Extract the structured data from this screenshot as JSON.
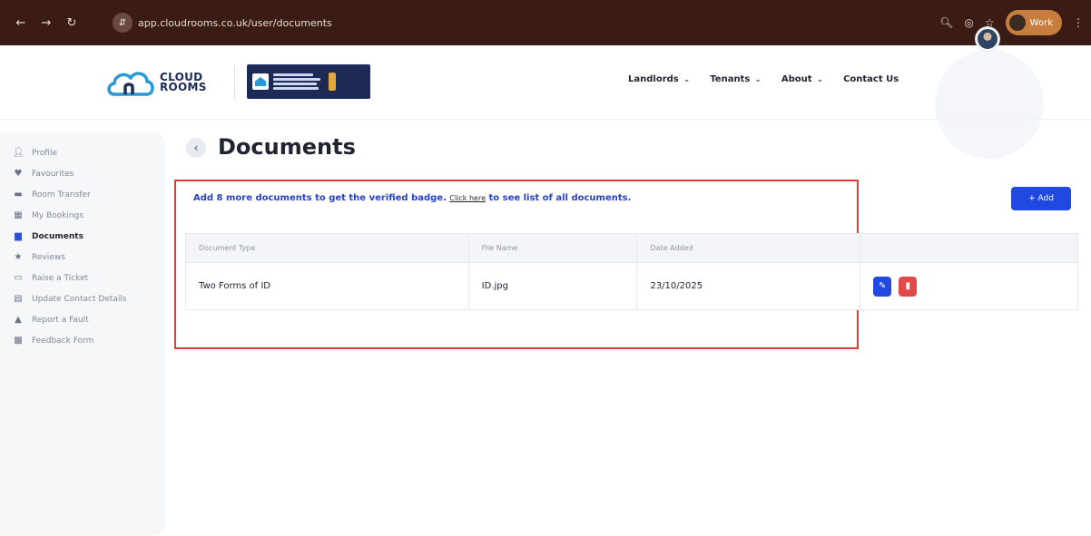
{
  "browser": {
    "url": "app.cloudrooms.co.uk/user/documents",
    "profile_label": "Work"
  },
  "header": {
    "logo_line1": "CLOUD",
    "logo_line2": "ROOMS",
    "nav": [
      {
        "label": "Landlords"
      },
      {
        "label": "Tenants"
      },
      {
        "label": "About"
      },
      {
        "label": "Contact Us"
      }
    ]
  },
  "sidebar": {
    "items": [
      {
        "label": "Profile",
        "icon": "person-icon"
      },
      {
        "label": "Favourites",
        "icon": "heart-icon"
      },
      {
        "label": "Room Transfer",
        "icon": "bed-icon"
      },
      {
        "label": "My Bookings",
        "icon": "building-icon"
      },
      {
        "label": "Documents",
        "icon": "document-icon",
        "active": true
      },
      {
        "label": "Reviews",
        "icon": "star-icon"
      },
      {
        "label": "Raise a Ticket",
        "icon": "ticket-icon"
      },
      {
        "label": "Update Contact Details",
        "icon": "contact-card-icon"
      },
      {
        "label": "Report a Fault",
        "icon": "warning-icon"
      },
      {
        "label": "Feedback Form",
        "icon": "form-icon"
      }
    ]
  },
  "main": {
    "title": "Documents",
    "verify_prefix": "Add 8 more documents to get the verified badge.",
    "click_here": "Click here",
    "verify_suffix": "to see list of all documents.",
    "add_button": "+ Add",
    "table": {
      "headers": [
        "Document Type",
        "File Name",
        "Date Added",
        ""
      ],
      "rows": [
        {
          "type": "Two Forms of ID",
          "file": "ID.jpg",
          "date": "23/10/2025"
        }
      ]
    }
  },
  "colors": {
    "accent": "#1f49e0",
    "danger": "#e24a4a",
    "highlight": "#e23b3b"
  }
}
